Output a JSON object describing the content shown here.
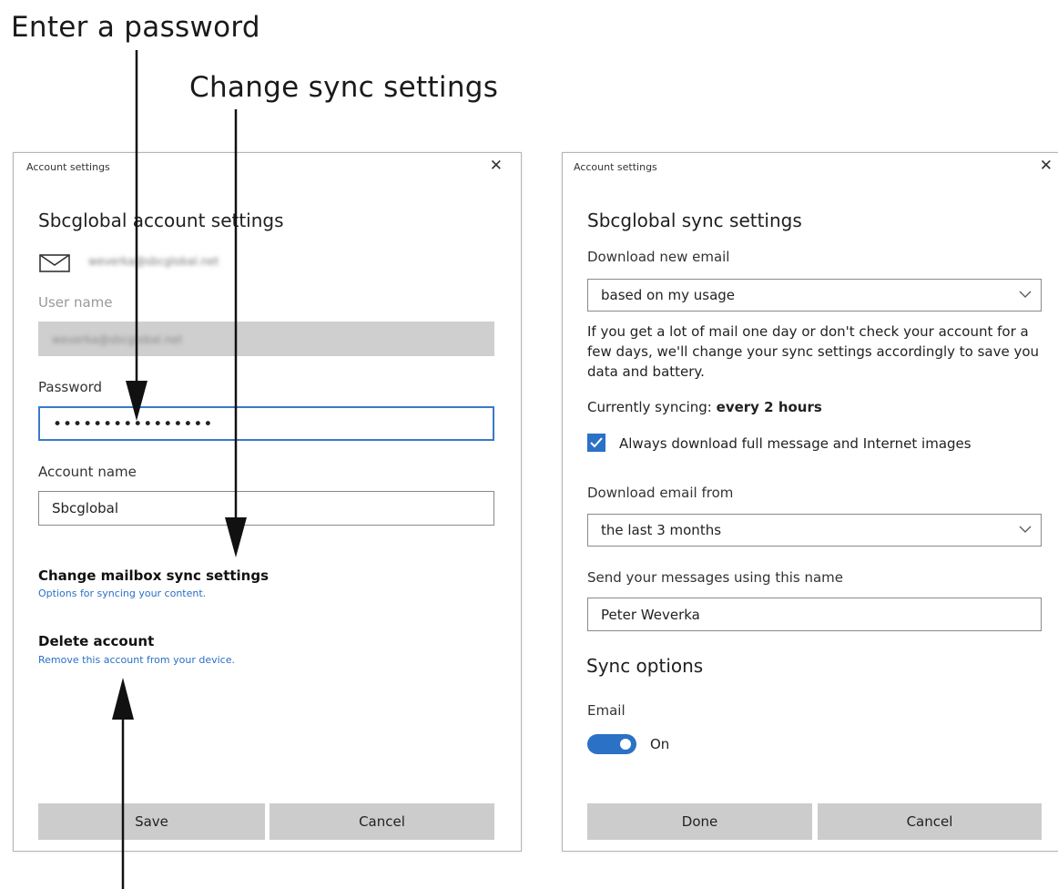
{
  "callouts": {
    "password": "Enter a password",
    "sync": "Change sync settings"
  },
  "left_dialog": {
    "window_title": "Account settings",
    "close_glyph": "✕",
    "heading": "Sbcglobal account settings",
    "email": "weverka@sbcglobal.net",
    "username_label": "User name",
    "username_value": "weverka@sbcglobal.net",
    "password_label": "Password",
    "password_value": "••••••••••••••••",
    "account_name_label": "Account name",
    "account_name_value": "Sbcglobal",
    "sync_link_title": "Change mailbox sync settings",
    "sync_link_sub": "Options for syncing your content.",
    "delete_title": "Delete account",
    "delete_sub": "Remove this account from your device.",
    "save_label": "Save",
    "cancel_label": "Cancel"
  },
  "right_dialog": {
    "window_title": "Account settings",
    "close_glyph": "✕",
    "heading": "Sbcglobal sync settings",
    "download_label": "Download new email",
    "download_value": "based on my usage",
    "info_text": "If you get a lot of mail one day or don't check your account for a few days, we'll change your sync settings accordingly to save you data and battery.",
    "currently_syncing_label": "Currently syncing:",
    "currently_syncing_value": "every 2 hours",
    "checkbox_label": "Always download full message and Internet images",
    "checkbox_checked": true,
    "download_from_label": "Download email from",
    "download_from_value": "the last 3 months",
    "send_name_label": "Send your messages using this name",
    "send_name_value": "Peter Weverka",
    "sync_options_heading": "Sync options",
    "email_label": "Email",
    "toggle_state": "On",
    "done_label": "Done",
    "cancel_label": "Cancel"
  },
  "colors": {
    "accent": "#2b71c6",
    "link": "#2a6fc6",
    "button_bg": "#cccccc",
    "disabled_field": "#cfcfcf"
  },
  "icons": [
    "envelope-icon",
    "close-icon",
    "chevron-down-icon",
    "checkmark-icon"
  ]
}
